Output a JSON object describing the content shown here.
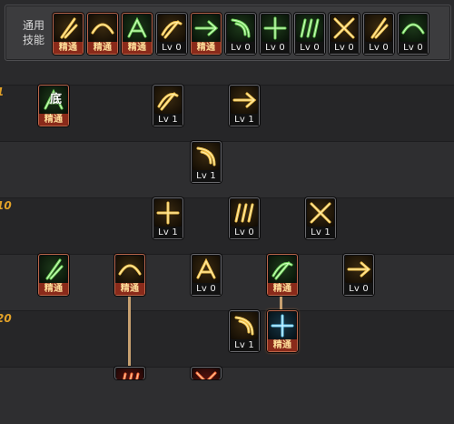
{
  "common_panel": {
    "label_line1": "通用",
    "label_line2": "技能",
    "skills": [
      {
        "icon": "figure-kneel-icon",
        "level": "精通",
        "mastered": true,
        "theme": "gold"
      },
      {
        "icon": "figure-leap-icon",
        "level": "精通",
        "mastered": true,
        "theme": "gold"
      },
      {
        "icon": "figure-strike-icon",
        "level": "精通",
        "mastered": true,
        "theme": "green"
      },
      {
        "icon": "wing-emblem-icon",
        "level": "Lv 0",
        "mastered": false,
        "theme": "gold"
      },
      {
        "icon": "crosshair-icon",
        "level": "精通",
        "mastered": true,
        "theme": "green"
      },
      {
        "icon": "target-burst-icon",
        "level": "Lv 0",
        "mastered": false,
        "theme": "green"
      },
      {
        "icon": "figure-dash-icon",
        "level": "Lv 0",
        "mastered": false,
        "theme": "green"
      },
      {
        "icon": "figure-guard-icon",
        "level": "Lv 0",
        "mastered": false,
        "theme": "green"
      },
      {
        "icon": "eye-swirl-icon",
        "level": "Lv 0",
        "mastered": false,
        "theme": "gold"
      },
      {
        "icon": "figure-power-icon",
        "level": "Lv 0",
        "mastered": false,
        "theme": "gold"
      },
      {
        "icon": "figure-bow-icon",
        "level": "Lv 0",
        "mastered": false,
        "theme": "green"
      }
    ]
  },
  "tree": {
    "level_labels": [
      "1",
      "10",
      "20"
    ],
    "skills": [
      {
        "icon": "base-glyph-icon",
        "glyph": "底",
        "level": "精通",
        "mastered": true,
        "theme": "green"
      },
      {
        "icon": "thrust-arrow-icon",
        "level": "Lv 1",
        "mastered": false,
        "theme": "gold"
      },
      {
        "icon": "sickle-slash-icon",
        "level": "Lv 1",
        "mastered": false,
        "theme": "gold"
      },
      {
        "icon": "crescent-slash-icon",
        "level": "Lv 1",
        "mastered": false,
        "theme": "gold"
      },
      {
        "icon": "spiral-cut-icon",
        "level": "Lv 1",
        "mastered": false,
        "theme": "gold"
      },
      {
        "icon": "triple-claw-icon",
        "level": "Lv 0",
        "mastered": false,
        "theme": "gold"
      },
      {
        "icon": "cross-strike-icon",
        "level": "Lv 1",
        "mastered": false,
        "theme": "gold"
      },
      {
        "icon": "green-claw-icon",
        "level": "精通",
        "mastered": true,
        "theme": "green"
      },
      {
        "icon": "rising-spear-icon",
        "level": "精通",
        "mastered": true,
        "theme": "gold"
      },
      {
        "icon": "wave-slash-icon",
        "level": "Lv 0",
        "mastered": false,
        "theme": "gold"
      },
      {
        "icon": "green-burst-icon",
        "level": "精通",
        "mastered": true,
        "theme": "green"
      },
      {
        "icon": "arc-slash-icon",
        "level": "Lv 0",
        "mastered": false,
        "theme": "gold"
      },
      {
        "icon": "aerial-cut-icon",
        "level": "Lv 1",
        "mastered": false,
        "theme": "gold"
      },
      {
        "icon": "frost-slash-icon",
        "level": "精通",
        "mastered": true,
        "theme": "blue"
      },
      {
        "icon": "flame-strike-icon",
        "level": "",
        "mastered": false,
        "theme": "red"
      },
      {
        "icon": "flame-burst-icon",
        "level": "",
        "mastered": false,
        "theme": "red"
      }
    ]
  }
}
